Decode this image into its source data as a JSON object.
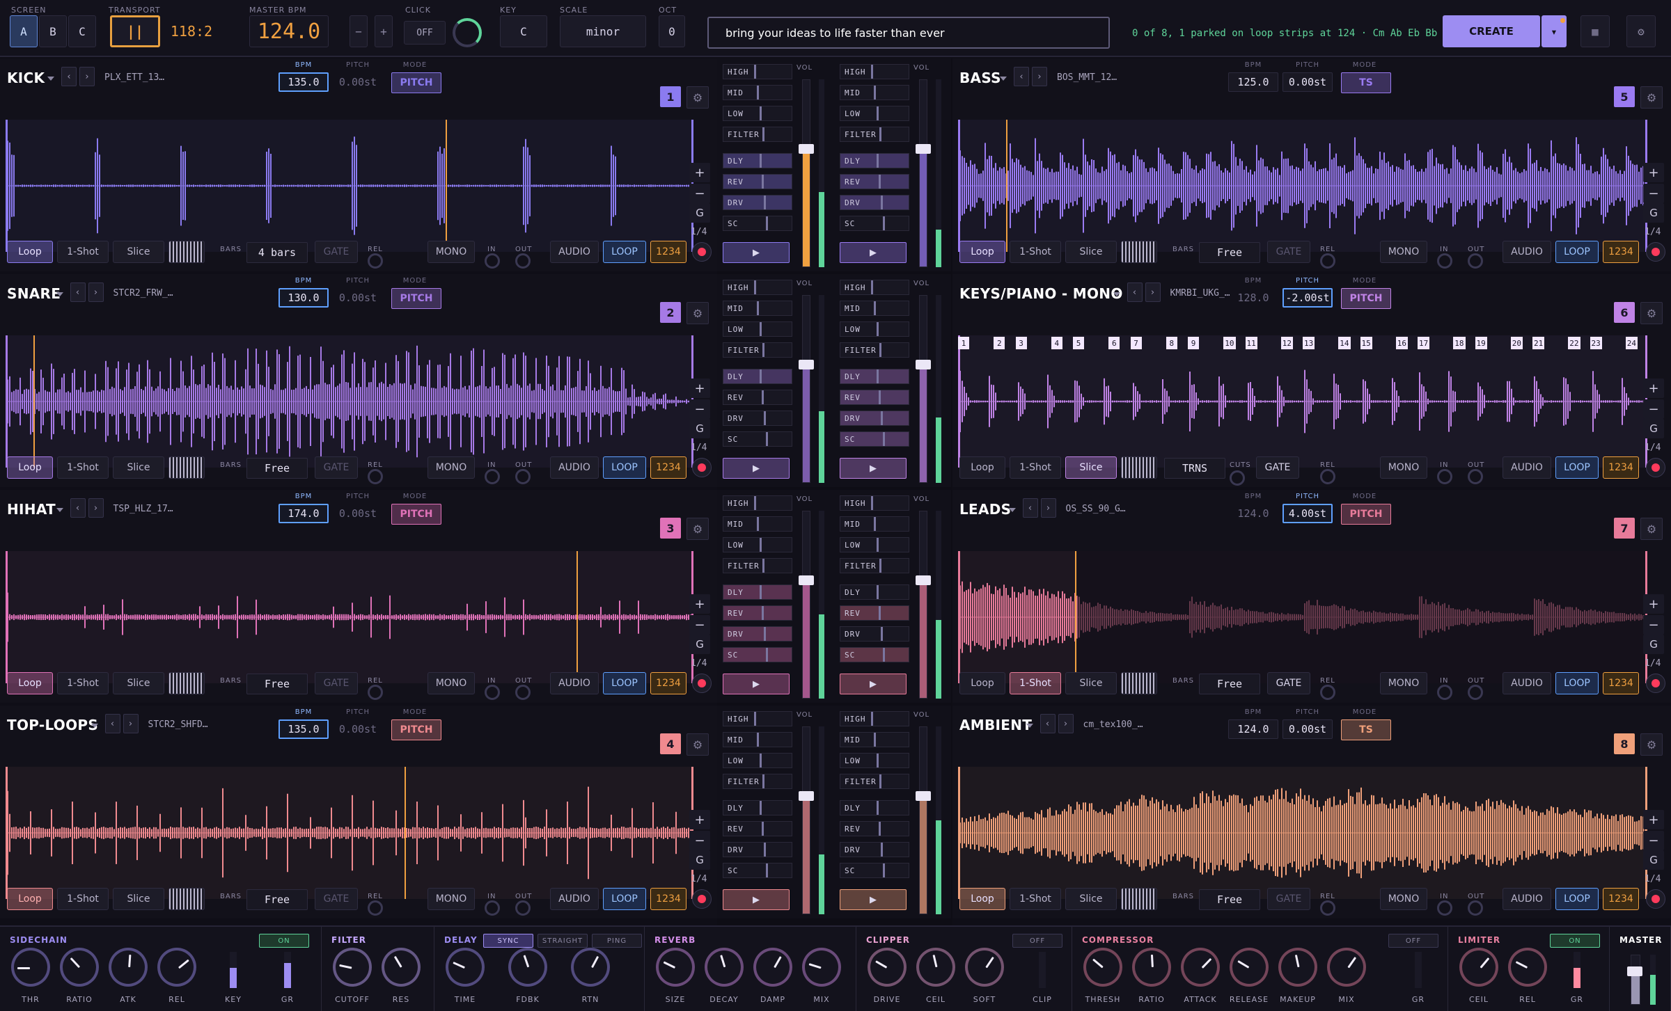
{
  "topbar": {
    "screen_label": "SCREEN",
    "screens": [
      "A",
      "B",
      "C"
    ],
    "transport_label": "TRANSPORT",
    "pause_glyph": "||",
    "position": "118:2",
    "master_bpm_label": "MASTER BPM",
    "master_bpm": "124.0",
    "minus": "−",
    "plus": "+",
    "click_label": "CLICK",
    "click_value": "OFF",
    "key_label": "KEY",
    "key_value": "C",
    "scale_label": "SCALE",
    "scale_value": "minor",
    "oct_label": "OCT",
    "oct_value": "0",
    "prompt_value": "bring your ideas to life faster than ever",
    "status_text": "0 of 8, 1 parked on loop strips at 124 · Cm Ab Eb Bb",
    "create_label": "CREATE",
    "create_arrow": "▾",
    "stop_glyph": "■",
    "settings_glyph": "⚙"
  },
  "labels": {
    "bpm": "BPM",
    "pitch": "PITCH",
    "mode": "MODE",
    "vol": "VOL",
    "loop": "Loop",
    "oneshot": "1-Shot",
    "slice": "Slice",
    "bars": "BARS",
    "gate": "GATE",
    "rel": "REL",
    "mono": "MONO",
    "in": "IN",
    "out": "OUT",
    "audio": "AUDIO",
    "loop_caps": "LOOP",
    "n1234": "1234",
    "trns": "TRNS",
    "cuts": "CUTS",
    "plus": "+",
    "minus": "−",
    "g": "G",
    "quarter": "1/4",
    "prev": "‹",
    "next": "›",
    "gear": "⚙",
    "play": "▶",
    "eq": [
      "HIGH",
      "MID",
      "LOW",
      "FILTER"
    ],
    "sends": [
      "DLY",
      "REV",
      "DRV",
      "SC"
    ]
  },
  "strips": [
    {
      "name": "KICK",
      "file": "PLX_ETT_13…",
      "bpm": "135.0",
      "pitch": "0.00st",
      "mode": "PITCH",
      "num": "1",
      "bars": "4 bars",
      "active_mode": "loop",
      "color": "#8b7bf0",
      "wave": "kick"
    },
    {
      "name": "SNARE",
      "file": "STCR2_FRW_…",
      "bpm": "130.0",
      "pitch": "0.00st",
      "mode": "PITCH",
      "num": "2",
      "bars": "Free",
      "active_mode": "loop",
      "color": "#a67ae6",
      "wave": "snare"
    },
    {
      "name": "HIHAT",
      "file": "TSP_HLZ_17…",
      "bpm": "174.0",
      "pitch": "0.00st",
      "mode": "PITCH",
      "num": "3",
      "bars": "Free",
      "active_mode": "loop",
      "color": "#e072b8",
      "wave": "hihat"
    },
    {
      "name": "TOP-LOOPS",
      "file": "STCR2_SHFD…",
      "bpm": "135.0",
      "pitch": "0.00st",
      "mode": "PITCH",
      "num": "4",
      "bars": "Free",
      "active_mode": "loop",
      "color": "#f08a8f",
      "wave": "top"
    },
    {
      "name": "BASS",
      "file": "BOS_MMT_12…",
      "bpm": "125.0",
      "pitch": "0.00st",
      "mode": "TS",
      "num": "5",
      "bars": "Free",
      "active_mode": "loop",
      "color": "#9a7bf2",
      "wave": "bass"
    },
    {
      "name": "KEYS/PIANO - MONO",
      "file": "KMRBI_UKG_…",
      "bpm": "128.0",
      "pitch": "-2.00st",
      "mode": "PITCH",
      "num": "6",
      "bars": "TRNS",
      "active_mode": "slice",
      "color": "#c083e6",
      "wave": "keys"
    },
    {
      "name": "LEADS",
      "file": "OS_SS_90_G…",
      "bpm": "124.0",
      "pitch": "4.00st",
      "mode": "PITCH",
      "num": "7",
      "bars": "Free",
      "active_mode": "oneshot",
      "color": "#e87b9a",
      "wave": "leads"
    },
    {
      "name": "AMBIENT",
      "file": "cm_tex100_…",
      "bpm": "124.0",
      "pitch": "0.00st",
      "mode": "TS",
      "num": "8",
      "bars": "Free",
      "active_mode": "loop",
      "color": "#f0a07a",
      "wave": "ambient"
    }
  ],
  "slice_numbers": [
    "1",
    "2",
    "3",
    "4",
    "5",
    "6",
    "7",
    "8",
    "9",
    "10",
    "11",
    "12",
    "13",
    "14",
    "15",
    "16",
    "17",
    "18",
    "19",
    "20",
    "21",
    "22",
    "23",
    "24"
  ],
  "fx": {
    "sidechain": {
      "title": "SIDECHAIN",
      "state": "ON",
      "knobs": [
        "THR",
        "RATIO",
        "ATK",
        "REL"
      ],
      "meters": [
        "KEY",
        "GR"
      ]
    },
    "filter": {
      "title": "FILTER",
      "knobs": [
        "CUTOFF",
        "RES"
      ]
    },
    "delay": {
      "title": "DELAY",
      "modes": [
        "SYNC",
        "STRAIGHT",
        "PING"
      ],
      "knobs": [
        "TIME",
        "FDBK",
        "RTN"
      ]
    },
    "reverb": {
      "title": "REVERB",
      "knobs": [
        "SIZE",
        "DECAY",
        "DAMP",
        "MIX"
      ]
    },
    "clipper": {
      "title": "CLIPPER",
      "state": "OFF",
      "knobs": [
        "DRIVE",
        "CEIL",
        "SOFT"
      ],
      "meters": [
        "CLIP"
      ]
    },
    "compressor": {
      "title": "COMPRESSOR",
      "state": "OFF",
      "knobs": [
        "THRESH",
        "RATIO",
        "ATTACK",
        "RELEASE",
        "MAKEUP",
        "MIX"
      ],
      "meters": [
        "GR"
      ]
    },
    "limiter": {
      "title": "LIMITER",
      "state": "ON",
      "knobs": [
        "CEIL",
        "REL"
      ],
      "meters": [
        "GR"
      ]
    },
    "master": {
      "title": "MASTER"
    }
  },
  "colors": {
    "accent": "#8b7bf0",
    "amber": "#f0a040",
    "bg": "#0f0e17",
    "green": "#5fd49a",
    "blue": "#5fa0ff",
    "red": "#ff3b5c"
  }
}
